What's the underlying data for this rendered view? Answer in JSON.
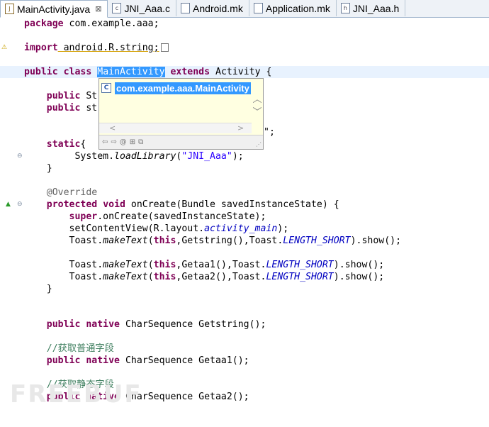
{
  "tabs": [
    {
      "label": "MainActivity.java",
      "active": true,
      "icon": "java-file-icon",
      "close": "⊠"
    },
    {
      "label": "JNI_Aaa.c",
      "active": false,
      "icon": "c-file-icon"
    },
    {
      "label": "Android.mk",
      "active": false,
      "icon": "mk-file-icon"
    },
    {
      "label": "Application.mk",
      "active": false,
      "icon": "mk-file-icon"
    },
    {
      "label": "JNI_Aaa.h",
      "active": false,
      "icon": "h-file-icon"
    }
  ],
  "code": {
    "l1": {
      "kw": "package",
      "rest": " com.example.aaa;"
    },
    "l3": {
      "kw": "import",
      "rest": " android.R.string;"
    },
    "l5": {
      "kw1": "public",
      "kw2": "class",
      "cls": "MainActivity",
      "kw3": "extends",
      "rest": " Activity {"
    },
    "l7": {
      "kw": "public",
      "rest": " St"
    },
    "l8": {
      "kw": "public",
      "rest": " st",
      "tail": "\";"
    },
    "l10": {
      "kw": "static",
      "rest": "{"
    },
    "l11": {
      "pre": "System.",
      "it": "loadLibrary",
      "mid": "(",
      "str": "\"JNI_Aaa\"",
      "post": ");"
    },
    "l12": {
      "text": "}"
    },
    "l14": {
      "text": "@Override"
    },
    "l15": {
      "kw1": "protected",
      "kw2": "void",
      "rest": " onCreate(Bundle savedInstanceState) {"
    },
    "l16": {
      "kw": "super",
      "rest": ".onCreate(savedInstanceState);"
    },
    "l17": {
      "pre": "setContentView(R.layout.",
      "fld": "activity_main",
      "post": ");"
    },
    "l18": {
      "pre": "Toast.",
      "it": "makeText",
      "mid": "(",
      "kw": "this",
      "mid2": ",Getstring(),Toast.",
      "fld": "LENGTH_SHORT",
      "post": ").show();"
    },
    "l20": {
      "pre": "Toast.",
      "it": "makeText",
      "mid": "(",
      "kw": "this",
      "mid2": ",Getaa1(),Toast.",
      "fld": "LENGTH_SHORT",
      "post": ").show();"
    },
    "l21": {
      "pre": "Toast.",
      "it": "makeText",
      "mid": "(",
      "kw": "this",
      "mid2": ",Getaa2(),Toast.",
      "fld": "LENGTH_SHORT",
      "post": ").show();"
    },
    "l22": {
      "text": "}"
    },
    "l25": {
      "kw1": "public",
      "kw2": "native",
      "rest": " CharSequence Getstring();"
    },
    "l27": {
      "text": "//获取普通字段"
    },
    "l28": {
      "kw1": "public",
      "kw2": "native",
      "rest": " CharSequence Getaa1();"
    },
    "l30": {
      "text": "//获取静态字段"
    },
    "l31": {
      "kw1": "public",
      "kw2": "native",
      "rest": " CharSequence Getaa2();"
    }
  },
  "popup": {
    "suggestion": "com.example.aaa.MainActivity",
    "class_icon": "C",
    "up": "︿",
    "down": "﹀",
    "left": "<",
    "right": ">",
    "tool_icons": [
      "⇦",
      "⇨",
      "@",
      "⊞",
      "⧉"
    ]
  },
  "watermark": "FREEBUF"
}
